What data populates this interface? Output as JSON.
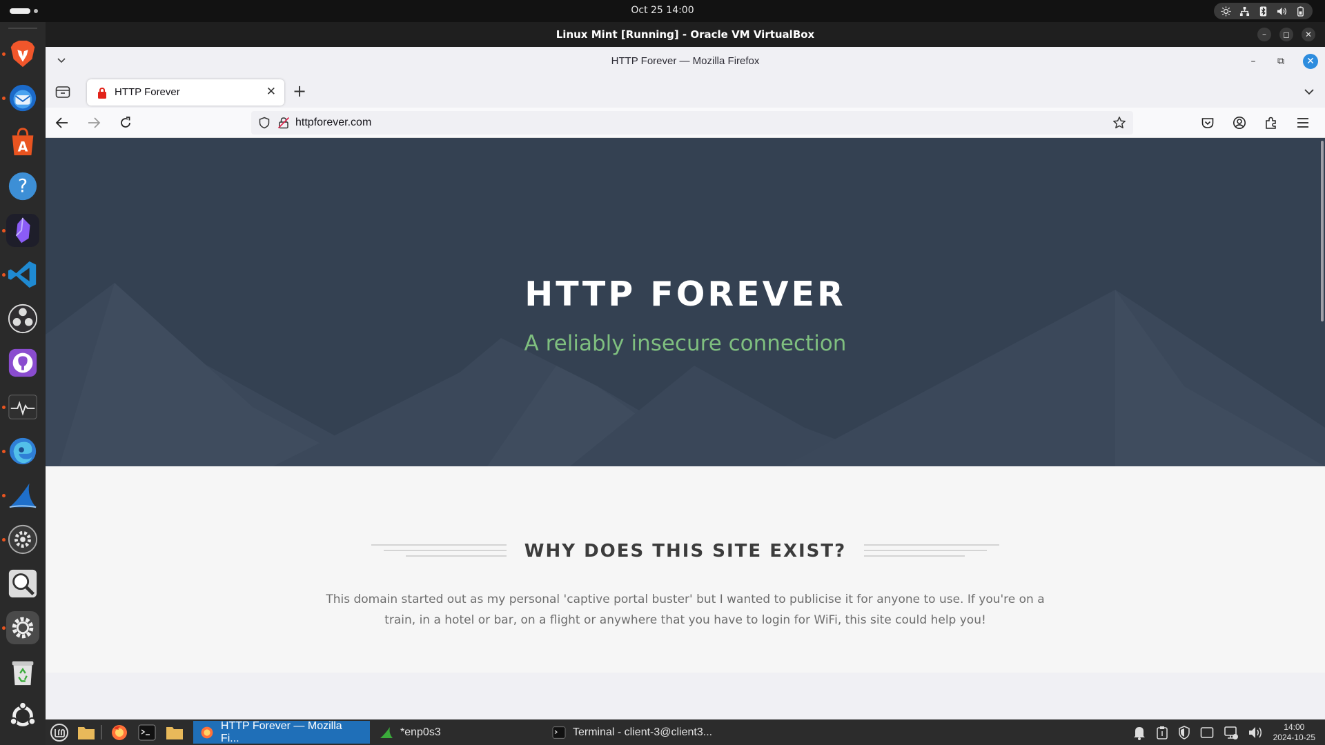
{
  "host": {
    "clock": "Oct 25  14:00",
    "window_title": "Linux Mint  [Running] - Oracle VM VirtualBox"
  },
  "dock": {
    "apps": [
      "brave",
      "thunderbird",
      "app-center",
      "help",
      "obsidian",
      "vscode",
      "obs-studio",
      "github-desktop",
      "system-monitor",
      "edge",
      "wireshark",
      "settings-wheel",
      "magnifier",
      "settings",
      "trash",
      "ubuntu"
    ]
  },
  "firefox": {
    "window_title": "HTTP Forever — Mozilla Firefox",
    "tab_title": "HTTP Forever",
    "url": "httpforever.com"
  },
  "page": {
    "hero_title": "HTTP FOREVER",
    "hero_subtitle": "A reliably insecure connection",
    "why_title": "WHY DOES THIS SITE EXIST?",
    "why_text": "This domain started out as my personal 'captive portal buster' but I wanted to publicise it for anyone to use. If you're on a train, in a hotel or bar, on a flight or anywhere that you have to login for WiFi, this site could help you!",
    "colors": {
      "hero_bg": "#344152",
      "subtitle": "#7fbf7f",
      "body_bg": "#f6f6f6"
    }
  },
  "taskbar": {
    "tasks": [
      {
        "label": "HTTP Forever — Mozilla Fi...",
        "active": true
      },
      {
        "label": "*enp0s3",
        "active": false
      },
      {
        "label": "Terminal - client-3@client3...",
        "active": false
      }
    ],
    "clock_time": "14:00",
    "clock_date": "2024-10-25"
  }
}
